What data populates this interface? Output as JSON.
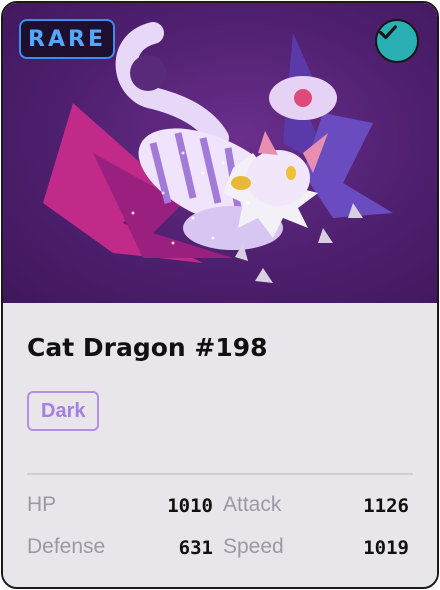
{
  "card": {
    "rarity": "RARE",
    "verified_icon": "checkmark-icon",
    "artwork_subject": "cat-dragon-illustration",
    "title": "Cat Dragon #198",
    "type": "Dark"
  },
  "stats": [
    {
      "label": "HP",
      "value": "1010"
    },
    {
      "label": "Attack",
      "value": "1126"
    },
    {
      "label": "Defense",
      "value": "631"
    },
    {
      "label": "Speed",
      "value": "1019"
    }
  ],
  "colors": {
    "rarity_accent": "#3a8ef0",
    "verified_badge": "#2ab0b4",
    "type_accent": "#b28ee6",
    "art_background": "#4e1f6e"
  }
}
